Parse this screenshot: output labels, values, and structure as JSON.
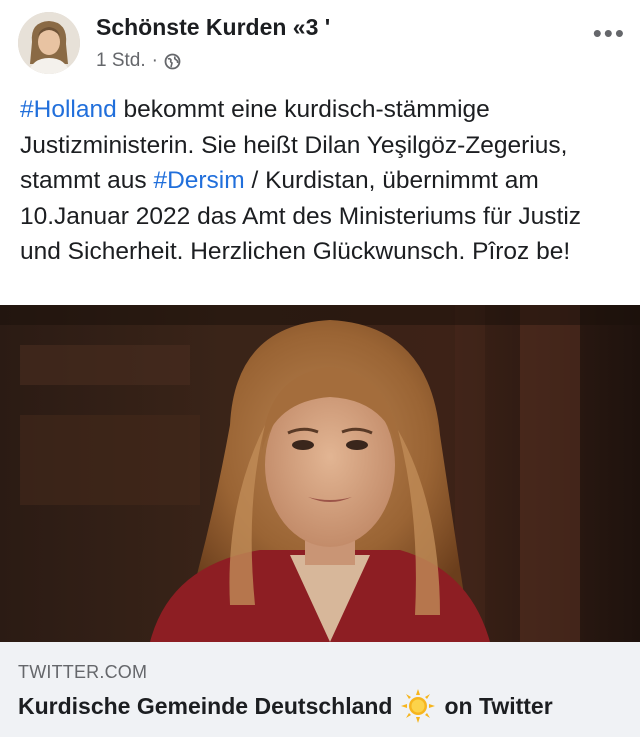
{
  "header": {
    "author_name": "Schönste Kurden «3 '",
    "timestamp": "1 Std.",
    "separator": "·",
    "privacy_icon": "globe-icon",
    "more_icon": "more-options-icon"
  },
  "post": {
    "hashtag_holland": "#Holland",
    "text_part1": " bekommt eine kurdisch-stämmige Justizministerin. Sie heißt Dilan Yeşilgöz-Zegerius, stammt aus ",
    "hashtag_dersim": "#Dersim",
    "text_part2": " / Kurdistan, übernimmt am 10.Januar 2022 das Amt des Ministeriums für Justiz und Sicherheit. Herzlichen Glückwunsch. Pîroz be!"
  },
  "link_preview": {
    "domain": "TWITTER.COM",
    "title_before": "Kurdische Gemeinde Deutschland",
    "title_after": "on Twitter",
    "emoji_icon": "sun-icon"
  },
  "colors": {
    "hashtag": "#216fdb",
    "secondary_text": "#65676b",
    "preview_bg": "#f0f2f5"
  }
}
